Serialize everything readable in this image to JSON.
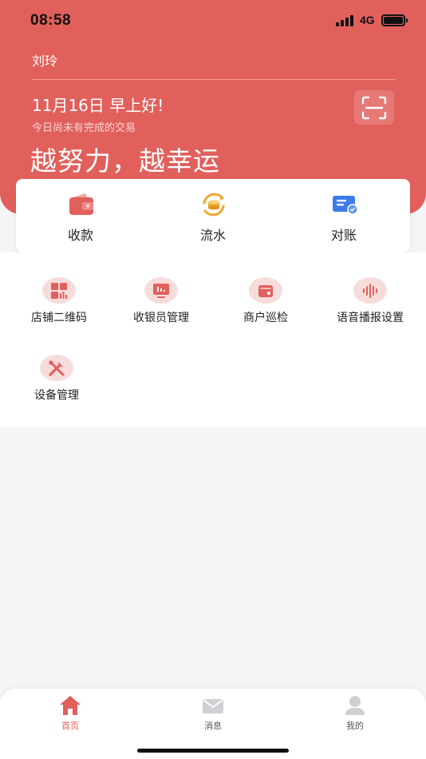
{
  "status_bar": {
    "time": "08:58",
    "network": "4G"
  },
  "header": {
    "user_name": "刘玲",
    "greeting": "11月16日 早上好!",
    "subtext": "今日尚未有完成的交易",
    "slogan": "越努力，越幸运",
    "scan_icon": "scan-icon"
  },
  "quick_actions": [
    {
      "label": "收款",
      "icon": "wallet-yuan-icon",
      "color": "#e1605c"
    },
    {
      "label": "流水",
      "icon": "coin-flow-icon",
      "color": "#f0a830"
    },
    {
      "label": "对账",
      "icon": "statement-icon",
      "color": "#3f7be8"
    }
  ],
  "functions": [
    {
      "label": "店铺二维码",
      "icon": "qr-grid-icon"
    },
    {
      "label": "收银员管理",
      "icon": "monitor-icon"
    },
    {
      "label": "商户巡检",
      "icon": "inspect-wallet-icon"
    },
    {
      "label": "语音播报设置",
      "icon": "sound-wave-icon"
    },
    {
      "label": "设备管理",
      "icon": "wrench-icon"
    }
  ],
  "tab_bar": {
    "items": [
      {
        "label": "首页",
        "icon": "home-icon",
        "active": true
      },
      {
        "label": "消息",
        "icon": "mail-icon",
        "active": false
      },
      {
        "label": "我的",
        "icon": "user-icon",
        "active": false
      }
    ]
  },
  "colors": {
    "primary": "#e1605c",
    "icon_bg": "#f7dcdc",
    "tab_active": "#e1605c",
    "tab_inactive": "#555555"
  }
}
